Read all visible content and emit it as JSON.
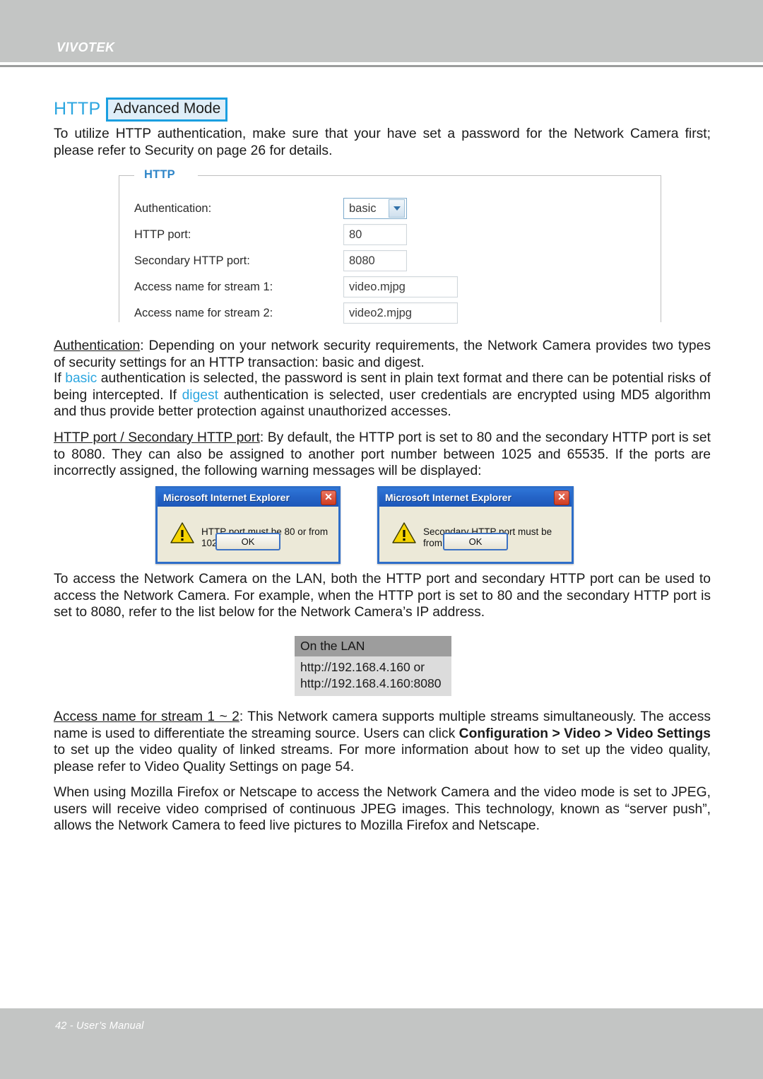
{
  "header": {
    "brand": "VIVOTEK"
  },
  "title": {
    "name": "HTTP",
    "badge": "Advanced Mode"
  },
  "intro": {
    "text": "To utilize HTTP authentication, make sure that your have set a password for the Network Camera first; please refer to Security on page 26 for details."
  },
  "panel": {
    "legend": "HTTP",
    "fields": [
      {
        "label": "Authentication:",
        "value": "basic",
        "type": "select"
      },
      {
        "label": "HTTP port:",
        "value": "80",
        "type": "text"
      },
      {
        "label": "Secondary HTTP port:",
        "value": "8080",
        "type": "text"
      },
      {
        "label": "Access name for stream 1:",
        "value": "video.mjpg",
        "type": "text"
      },
      {
        "label": "Access name for stream 2:",
        "value": "video2.mjpg",
        "type": "text"
      }
    ]
  },
  "authentication_section": {
    "term": "Authentication",
    "line1_after_term": ": Depending on your network security requirements, the Network Camera provides two types of security settings for an HTTP transaction: basic and digest.",
    "line2_a": "If ",
    "basic_word": "basic",
    "line2_b": " authentication is selected, the password is sent in plain text format and there can be potential risks of being intercepted. If ",
    "digest_word": "digest",
    "line2_c": " authentication is selected, user credentials are encrypted using MD5 algorithm and thus provide better protection against unauthorized accesses."
  },
  "port_section": {
    "term": "HTTP port / Secondary HTTP port",
    "body": ": By default, the HTTP port is set to 80 and the secondary HTTP port is set to 8080. They can also be assigned to another port number between 1025 and 65535. If the ports are incorrectly assigned, the following warning messages will be displayed:"
  },
  "dialogs": [
    {
      "title": "Microsoft Internet Explorer",
      "message": "HTTP port must be 80 or from 1025 to 65535",
      "ok_label": "OK",
      "close_glyph": "✕"
    },
    {
      "title": "Microsoft Internet Explorer",
      "message": "Secondary HTTP port must be from 1025 to 65535",
      "ok_label": "OK",
      "close_glyph": "✕"
    }
  ],
  "lan_access_section": {
    "body": "To access the Network Camera on the LAN, both the HTTP port and secondary HTTP port can be used to access the Network Camera. For example, when the HTTP port is set to 80 and the secondary HTTP port is set to 8080, refer to the list below for the Network Camera’s IP address."
  },
  "lan_table": {
    "header": "On the LAN",
    "line1": "http://192.168.4.160  or",
    "line2": "http://192.168.4.160:8080"
  },
  "stream_section": {
    "term": "Access name for stream 1 ~ 2",
    "part1": ": This Network camera supports multiple streams simultaneously. The access name is used to differentiate the streaming source. Users can click ",
    "bold1": "Configuration > Video > Video Settings",
    "part2": " to set up the video quality of linked streams. For more information about how to set up the video quality, please refer to Video Quality Settings on page 54."
  },
  "firefox_section": {
    "body": "When using Mozilla Firefox or Netscape to access the Network Camera and the video mode is set to JPEG, users will receive video comprised of continuous JPEG images. This technology, known as “server push”, allows the Network Camera to feed live pictures to Mozilla Firefox and Netscape."
  },
  "footer": {
    "text": "42 - User’s Manual"
  },
  "colors": {
    "accent_blue": "#2ca6e0",
    "legend_blue": "#2f86c8",
    "header_gray": "#c3c5c4",
    "table_header_gray": "#9d9d9d",
    "table_body_gray": "#dcdcdc"
  }
}
